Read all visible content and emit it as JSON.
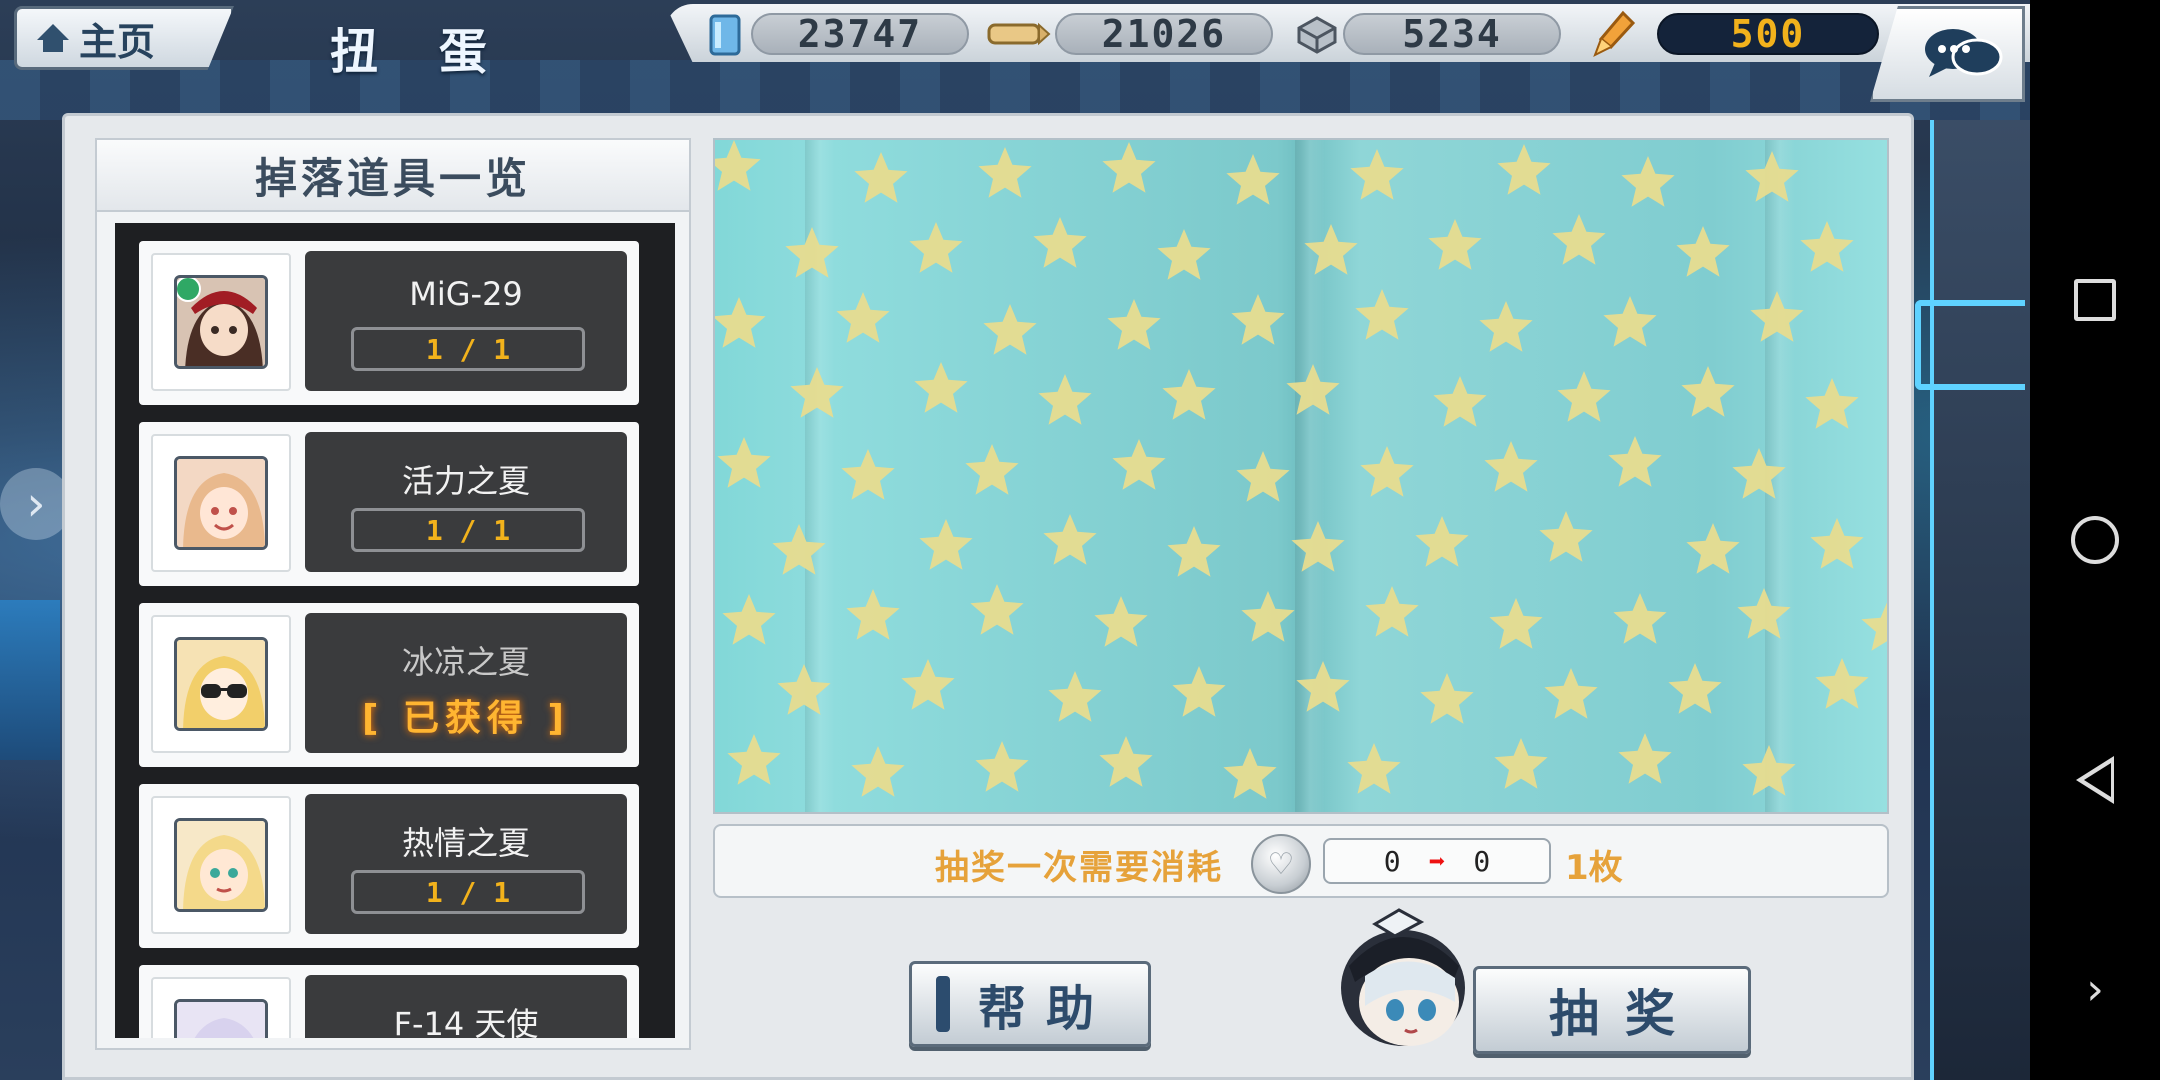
{
  "header": {
    "home_label": "主页",
    "title": "扭 蛋"
  },
  "currencies": [
    {
      "icon": "fuel-icon",
      "value": "23747"
    },
    {
      "icon": "ammo-icon",
      "value": "21026"
    },
    {
      "icon": "steel-icon",
      "value": "5234"
    },
    {
      "icon": "rocket-icon",
      "value": "500"
    }
  ],
  "drop_list": {
    "title": "掉落道具一览",
    "items": [
      {
        "name": "MiG-29",
        "count": "1 / 1",
        "obtained": false
      },
      {
        "name": "活力之夏",
        "count": "1 / 1",
        "obtained": false
      },
      {
        "name": "冰凉之夏",
        "status": "[  已获得  ]",
        "obtained": true
      },
      {
        "name": "热情之夏",
        "count": "1 / 1",
        "obtained": false
      },
      {
        "name": "F-14 天使",
        "count": "",
        "obtained": false
      }
    ]
  },
  "cost": {
    "label": "抽奖一次需要消耗",
    "from": "0",
    "to": "0",
    "unit": "1枚"
  },
  "buttons": {
    "help": "帮助",
    "draw": "抽奖"
  },
  "colors": {
    "accent_orange": "#e6a23a",
    "obtained_gold": "#ffb531",
    "count_gold": "#f2b21c",
    "button_text": "#2d4b6b"
  }
}
